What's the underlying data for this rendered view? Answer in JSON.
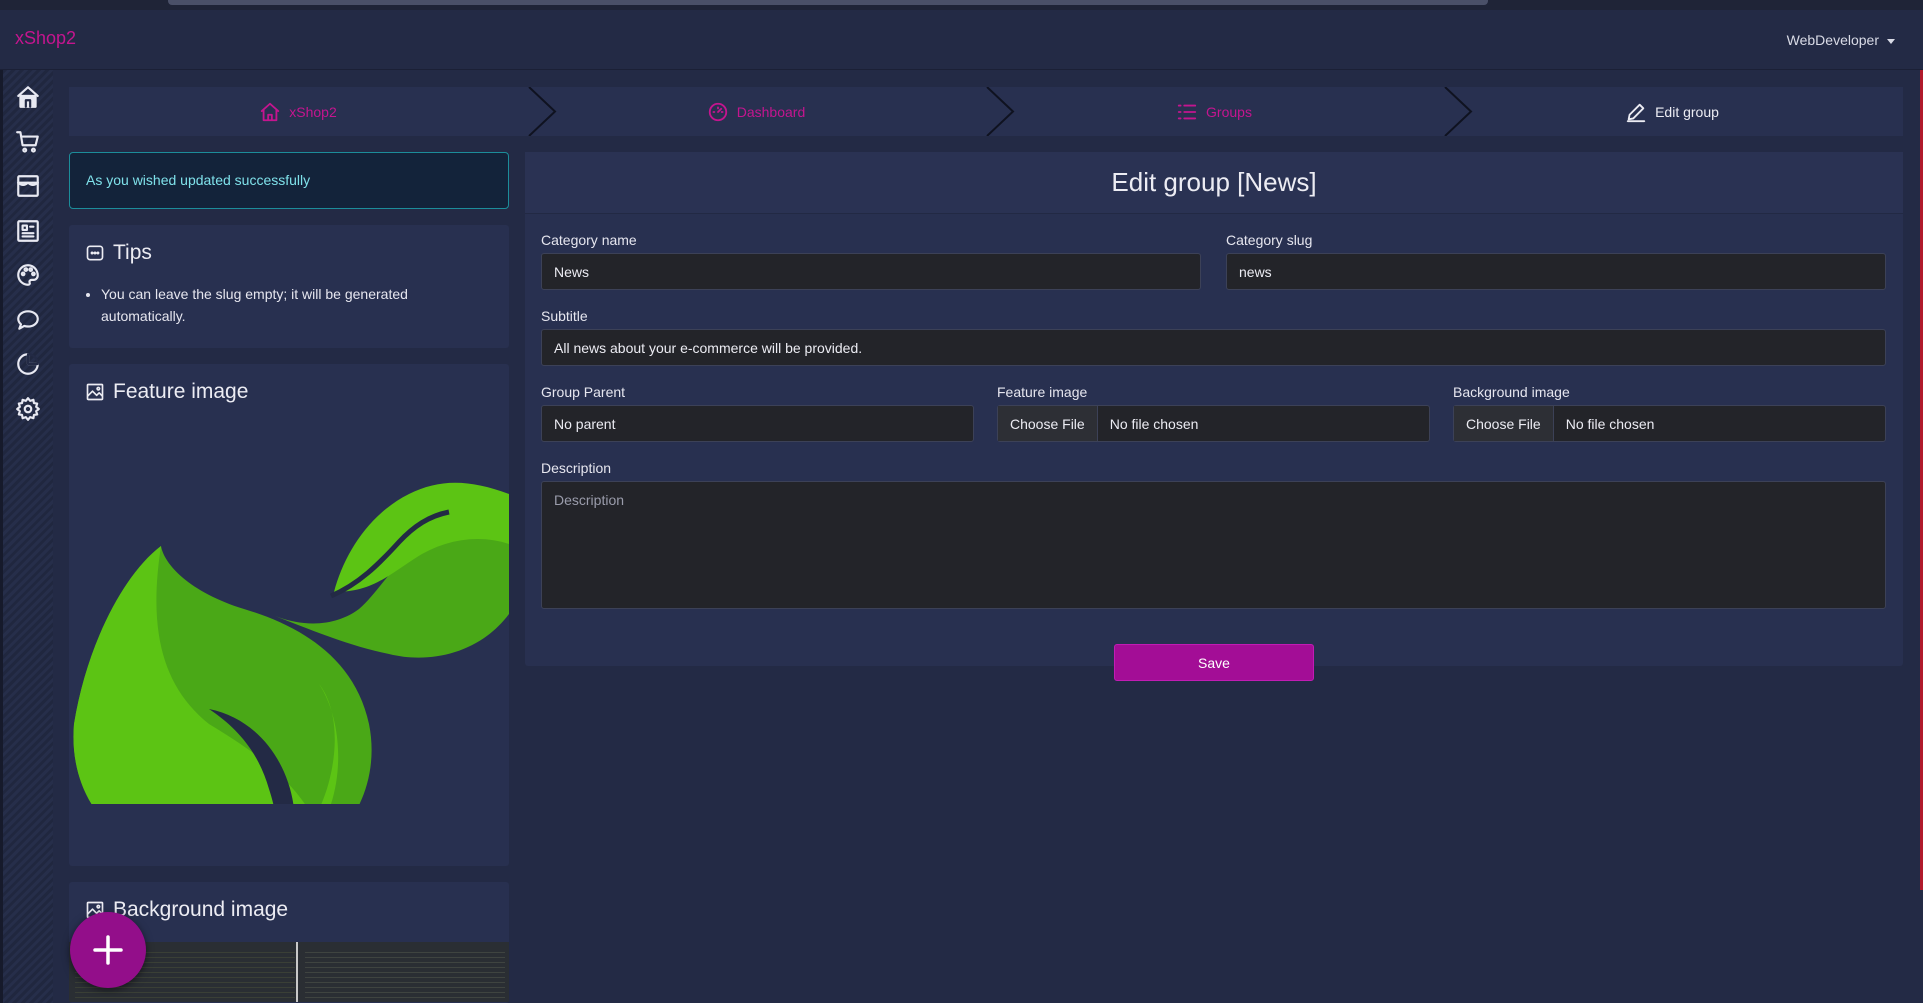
{
  "app": {
    "brand": "xShop2",
    "user": "WebDeveloper"
  },
  "colors": {
    "accent": "#c4158f",
    "primary_button": "#a30d96",
    "background": "#232a45",
    "card": "#283050",
    "alert_border": "#1c8d9a"
  },
  "sidebar": {
    "items": [
      {
        "icon": "home-icon"
      },
      {
        "icon": "cart-icon"
      },
      {
        "icon": "store-icon"
      },
      {
        "icon": "news-icon"
      },
      {
        "icon": "palette-icon"
      },
      {
        "icon": "comment-icon"
      },
      {
        "icon": "pie-chart-icon"
      },
      {
        "icon": "gear-icon"
      }
    ]
  },
  "breadcrumb": {
    "items": [
      {
        "label": "xShop2",
        "icon": "home-icon"
      },
      {
        "label": "Dashboard",
        "icon": "dashboard-icon"
      },
      {
        "label": "Groups",
        "icon": "list-icon"
      },
      {
        "label": "Edit group",
        "icon": "pencil-icon"
      }
    ]
  },
  "alert": {
    "message": "As you wished updated successfully"
  },
  "tips": {
    "title": "Tips",
    "items": [
      "You can leave the slug empty; it will be generated automatically."
    ]
  },
  "feature_card": {
    "title": "Feature image"
  },
  "background_card": {
    "title": "Background image"
  },
  "form": {
    "title": "Edit group [News]",
    "category_name": {
      "label": "Category name",
      "value": "News"
    },
    "category_slug": {
      "label": "Category slug",
      "value": "news"
    },
    "subtitle": {
      "label": "Subtitle",
      "value": "All news about your e-commerce will be provided."
    },
    "group_parent": {
      "label": "Group Parent",
      "value": "No parent"
    },
    "feature_image": {
      "label": "Feature image",
      "button": "Choose File",
      "status": "No file chosen"
    },
    "background_image": {
      "label": "Background image",
      "button": "Choose File",
      "status": "No file chosen"
    },
    "description": {
      "label": "Description",
      "placeholder": "Description"
    },
    "save_label": "Save"
  }
}
